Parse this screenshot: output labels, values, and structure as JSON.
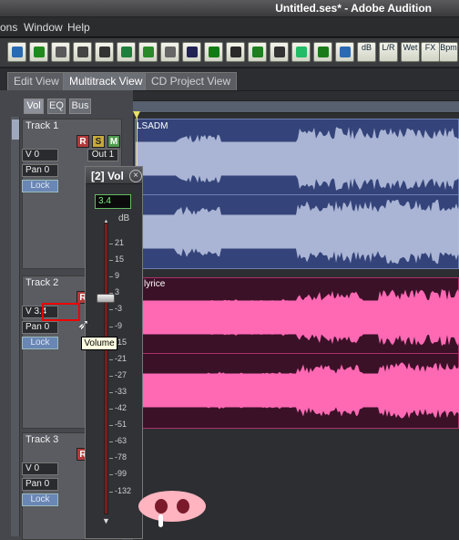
{
  "window": {
    "title": "Untitled.ses* - Adobe Audition"
  },
  "menu": [
    "ons",
    "Window",
    "Help"
  ],
  "toolbar": {
    "buttons": [
      "undo",
      "mixdown",
      "grid",
      "cursor",
      "scissors",
      "envelope",
      "lasso",
      "mute",
      "lock",
      "save",
      "list",
      "hybrid",
      "insert",
      "loop",
      "loop2",
      "eq"
    ],
    "labels": [
      "dB",
      "L/R",
      "Wet",
      "FX",
      "Bpm"
    ]
  },
  "tabs": [
    "Edit View",
    "Multitrack View",
    "CD Project View"
  ],
  "mixer_tabs": [
    "Vol",
    "EQ",
    "Bus"
  ],
  "tracks": [
    {
      "name": "Track 1",
      "volume": "V 0",
      "pan": "Pan 0",
      "lock": "Lock",
      "output": "Out 1",
      "buttons": [
        "R",
        "S",
        "M"
      ],
      "clip_label": "LSADM"
    },
    {
      "name": "Track 2",
      "volume": "V 3.4",
      "pan": "Pan 0",
      "lock": "Lock",
      "buttons": [
        "R"
      ],
      "clip_label": "lyrice"
    },
    {
      "name": "Track 3",
      "volume": "V 0",
      "pan": "Pan 0",
      "lock": "Lock",
      "buttons": [
        "R"
      ]
    }
  ],
  "volume_window": {
    "title": "[2] Vol",
    "value": "3.4",
    "unit": "dB",
    "slider_value_db": 3.4,
    "scale_labels": [
      "21",
      "15",
      "9",
      "3",
      "-3",
      "-9",
      "-15",
      "-21",
      "-27",
      "-33",
      "-42",
      "-51",
      "-63",
      "-78",
      "-99",
      "-132"
    ]
  },
  "tooltip": "Volume",
  "colors": {
    "track1_clip": "#34447a",
    "track2_clip": "#3b1128",
    "track1_wave": "#b7c1df",
    "track2_wave": "#ff69b4",
    "highlight": "#ff0000"
  }
}
